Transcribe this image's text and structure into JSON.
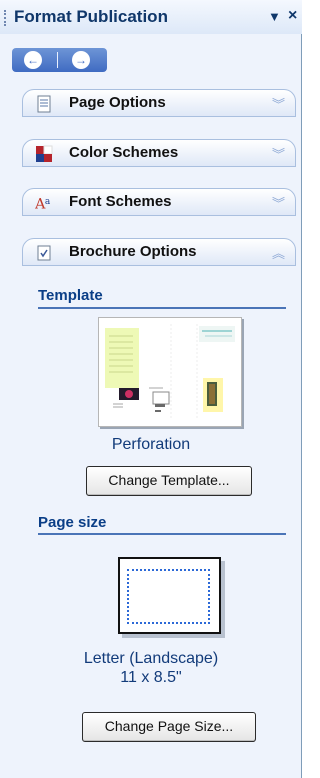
{
  "pane": {
    "title": "Format Publication",
    "menu_icon": "dropdown-arrow-icon",
    "close_icon": "close-icon",
    "nav": {
      "back_icon": "back-arrow-icon",
      "forward_icon": "forward-arrow-icon"
    }
  },
  "sections": [
    {
      "label": "Page Options",
      "icon": "page-icon",
      "expanded": false
    },
    {
      "label": "Color Schemes",
      "icon": "color-swatch-icon",
      "expanded": false
    },
    {
      "label": "Font Schemes",
      "icon": "font-icon",
      "expanded": false
    },
    {
      "label": "Brochure Options",
      "icon": "checklist-icon",
      "expanded": true
    }
  ],
  "brochure_options": {
    "template_heading": "Template",
    "template_name": "Perforation",
    "change_template_label": "Change Template...",
    "page_size_heading": "Page size",
    "page_size_name": "Letter (Landscape)",
    "page_size_dims": "11 x 8.5\"",
    "change_page_size_label": "Change Page Size..."
  },
  "colors": {
    "accent": "#0a3e87",
    "panel_bg": "#eef3fc",
    "header_blue": "#3f6bc2"
  }
}
